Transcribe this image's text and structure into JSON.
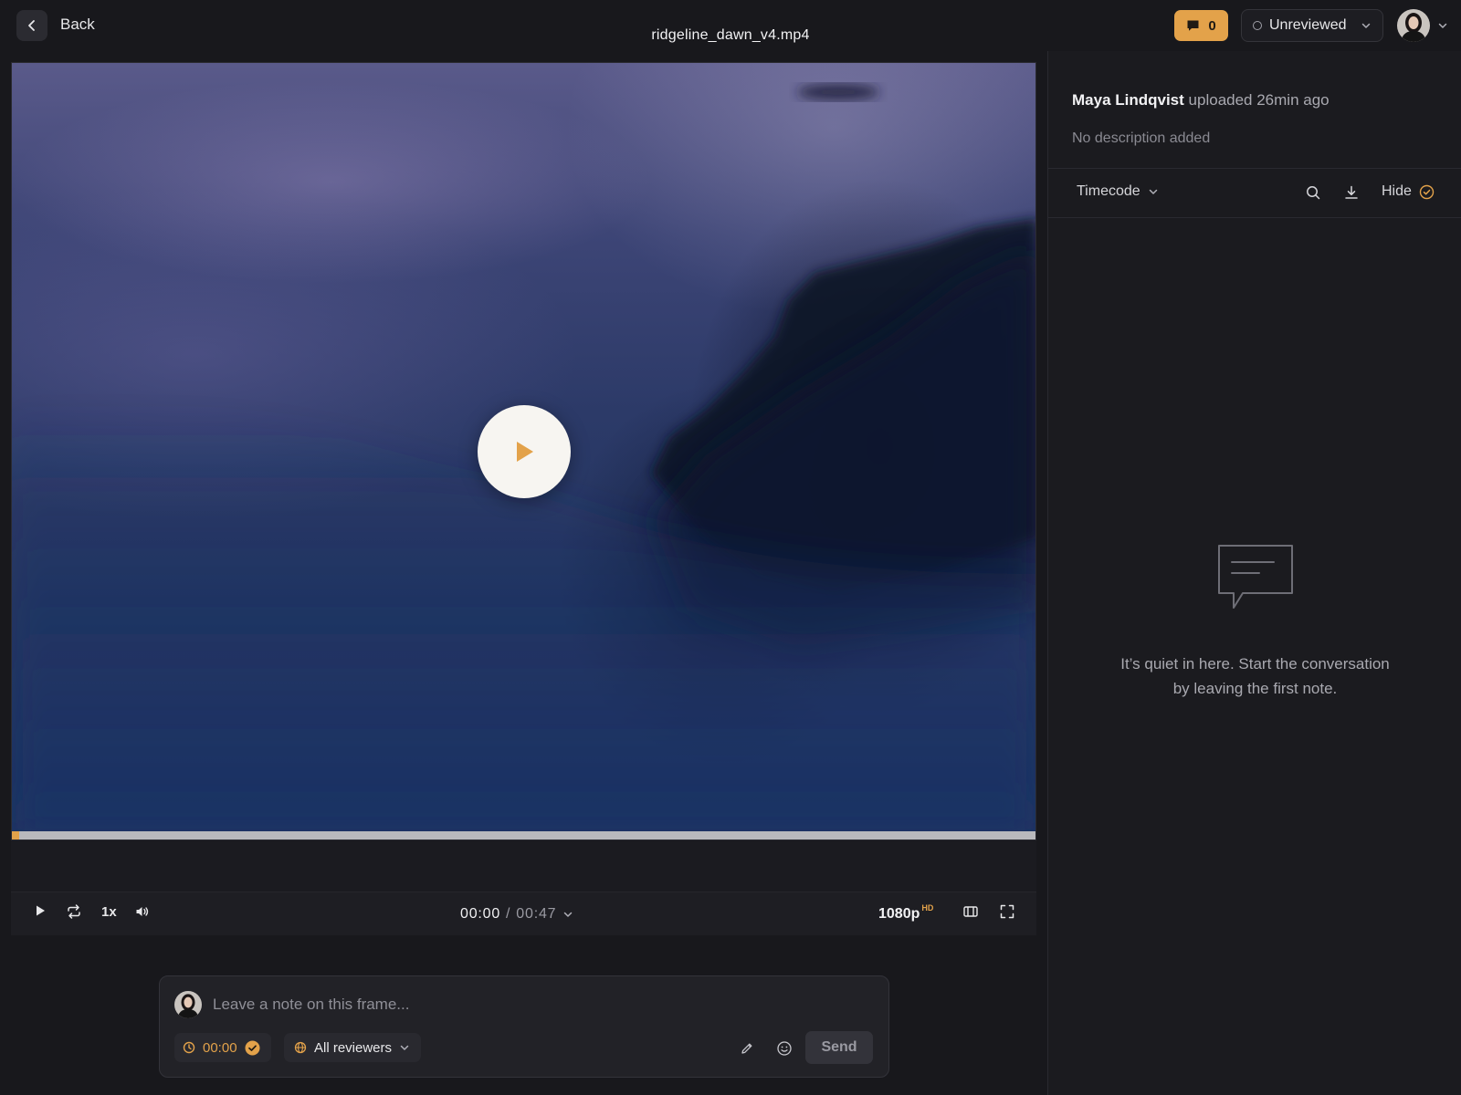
{
  "header": {
    "back_label": "Back",
    "file_title": "ridgeline_dawn_v4.mp4",
    "comment_count": "0",
    "status": "Unreviewed"
  },
  "player": {
    "progress_fraction": 0.005,
    "speed": "1x",
    "current_time": "00:00",
    "separator": "/",
    "total_time": "00:47",
    "quality": "1080p",
    "quality_badge": "HD"
  },
  "composer": {
    "placeholder": "Leave a note on this frame...",
    "timestamp": "00:00",
    "audience": "All reviewers",
    "send_label": "Send"
  },
  "panel": {
    "uploader_name": "Maya Lindqvist",
    "uploader_action": "uploaded 26min ago",
    "description": "No description added",
    "sort_label": "Timecode",
    "hide_label": "Hide",
    "empty_line1": "It’s quiet in here. Start the conversation",
    "empty_line2": "by leaving the first note."
  },
  "colors": {
    "accent": "#e3a24a",
    "background": "#18181c",
    "panel": "#1b1b1f"
  },
  "icons": [
    "chevron-left-icon",
    "comment-icon",
    "chevron-down-icon",
    "play-icon",
    "loop-icon",
    "volume-icon",
    "theater-mode-icon",
    "fullscreen-icon",
    "clock-icon",
    "check-circle-icon",
    "globe-icon",
    "pencil-icon",
    "emoji-icon",
    "search-icon",
    "download-icon",
    "speech-bubble-icon"
  ]
}
